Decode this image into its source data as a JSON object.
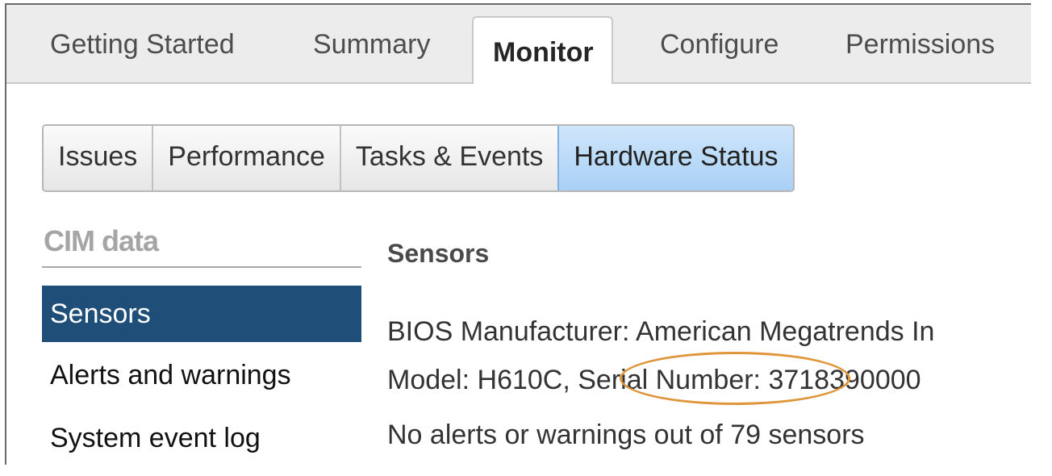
{
  "top_tabs": [
    "Getting Started",
    "Summary",
    "Monitor",
    "Configure",
    "Permissions"
  ],
  "active_top_tab": "Monitor",
  "sub_tabs": [
    "Issues",
    "Performance",
    "Tasks & Events",
    "Hardware Status"
  ],
  "active_sub_tab": "Hardware Status",
  "left_nav": {
    "title": "CIM data",
    "items": [
      "Sensors",
      "Alerts and warnings",
      "System event log"
    ],
    "active": "Sensors"
  },
  "content": {
    "section_title": "Sensors",
    "bios_label": "BIOS Manufacturer:",
    "bios_value": "American Megatrends In",
    "model_label": "Model:",
    "model_value": "H610C,",
    "serial_label": "Serial Number:",
    "serial_value": "3718390000",
    "sensor_summary": "No alerts or warnings out of 79 sensors"
  },
  "colors": {
    "active_subtab": "#a9d0f5",
    "active_nav": "#1f4e79",
    "highlight_circle": "#e0953b"
  }
}
